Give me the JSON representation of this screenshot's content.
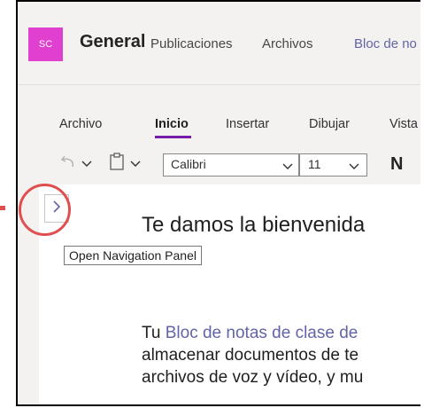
{
  "header": {
    "avatar_initials": "SC",
    "team_name": "General",
    "tabs": [
      {
        "label": "Publicaciones",
        "active": false
      },
      {
        "label": "Archivos",
        "active": false
      },
      {
        "label": "Bloc de no",
        "active": true
      }
    ]
  },
  "ribbon": {
    "tabs": [
      {
        "label": "Archivo",
        "active": false
      },
      {
        "label": "Inicio",
        "active": true
      },
      {
        "label": "Insertar",
        "active": false
      },
      {
        "label": "Dibujar",
        "active": false
      },
      {
        "label": "Vista",
        "active": false
      }
    ]
  },
  "toolbar": {
    "font_name": "Calibri",
    "font_size": "11",
    "bold_label": "N"
  },
  "navigation": {
    "tooltip": "Open Navigation Panel"
  },
  "page": {
    "title": "Te damos la bienvenida",
    "body_prefix": "Tu ",
    "body_link": "Bloc de notas de clase de",
    "body_line2": "almacenar documentos de te",
    "body_line3": "archivos de voz y vídeo, y mu"
  },
  "colors": {
    "accent": "#6264a7",
    "avatar": "#e03fcf",
    "highlight": "#e04f4f"
  }
}
